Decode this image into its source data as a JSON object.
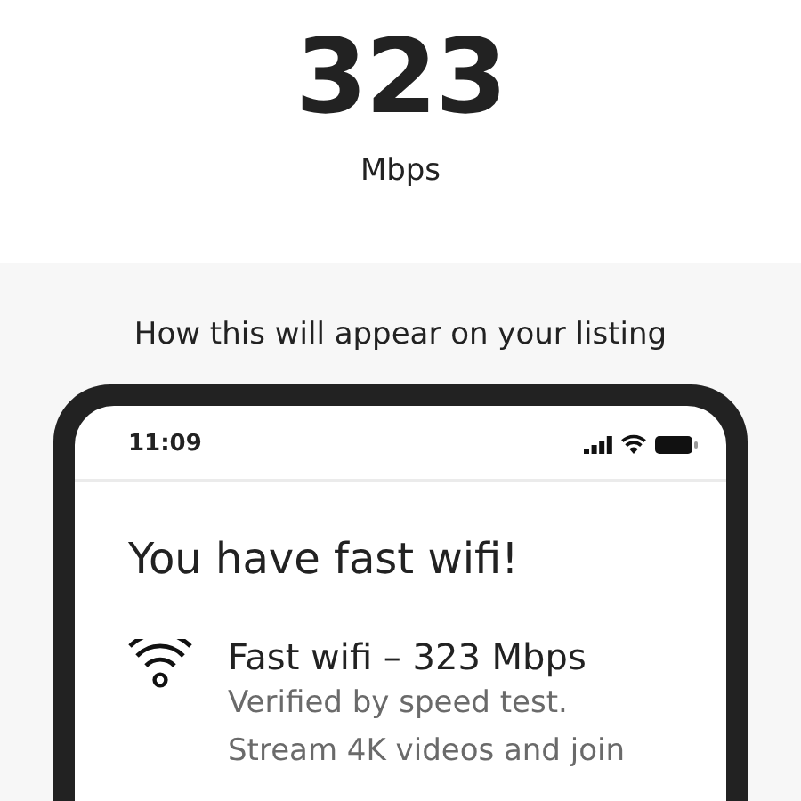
{
  "speed": {
    "value": "323",
    "unit": "Mbps"
  },
  "preview": {
    "heading": "How this will appear on your listing",
    "phone": {
      "time": "11:09",
      "title": "You have fast wifi!",
      "amenity": {
        "name": "Fast wifi – 323 Mbps",
        "description": [
          "Verified by speed test.",
          "Stream 4K videos and join"
        ]
      }
    }
  }
}
